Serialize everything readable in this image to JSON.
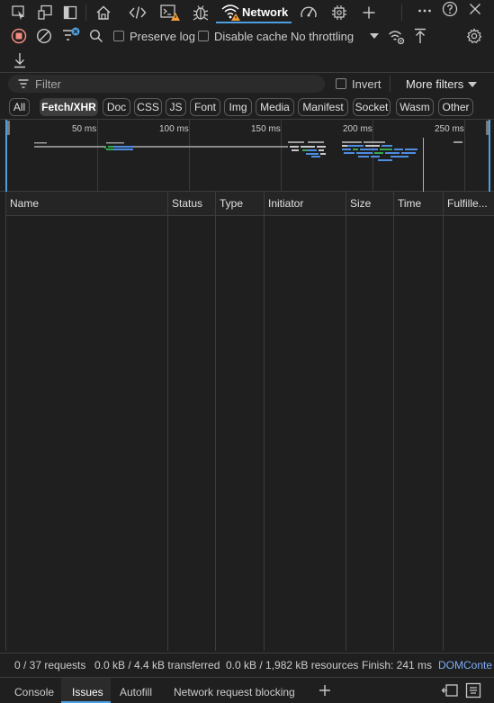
{
  "tabs": {
    "network_label": "Network"
  },
  "toolbar": {
    "preserve_log": "Preserve log",
    "disable_cache": "Disable cache",
    "throttling": "No throttling"
  },
  "filter": {
    "placeholder": "Filter",
    "invert": "Invert",
    "more_filters": "More filters"
  },
  "chips": [
    "All",
    "Fetch/XHR",
    "Doc",
    "CSS",
    "JS",
    "Font",
    "Img",
    "Media",
    "Manifest",
    "Socket",
    "Wasm",
    "Other"
  ],
  "active_chip": "Fetch/XHR",
  "overview": {
    "ticks": [
      "50 ms",
      "100 ms",
      "150 ms",
      "200 ms",
      "250 ms"
    ]
  },
  "columns": [
    "Name",
    "Status",
    "Type",
    "Initiator",
    "Size",
    "Time",
    "Fulfille..."
  ],
  "status": {
    "requests": "0 / 37 requests",
    "transferred": "0.0 kB / 4.4 kB transferred",
    "resources": "0.0 kB / 1,982 kB resources",
    "finish": "Finish: 241 ms",
    "dom": "DOMConte"
  },
  "drawer": {
    "tabs": [
      "Console",
      "Issues",
      "Autofill",
      "Network request blocking"
    ],
    "active": "Issues"
  },
  "colors": {
    "accent": "#4d9fe0",
    "record_red": "#f28b82",
    "warning_orange": "#f29d38"
  }
}
